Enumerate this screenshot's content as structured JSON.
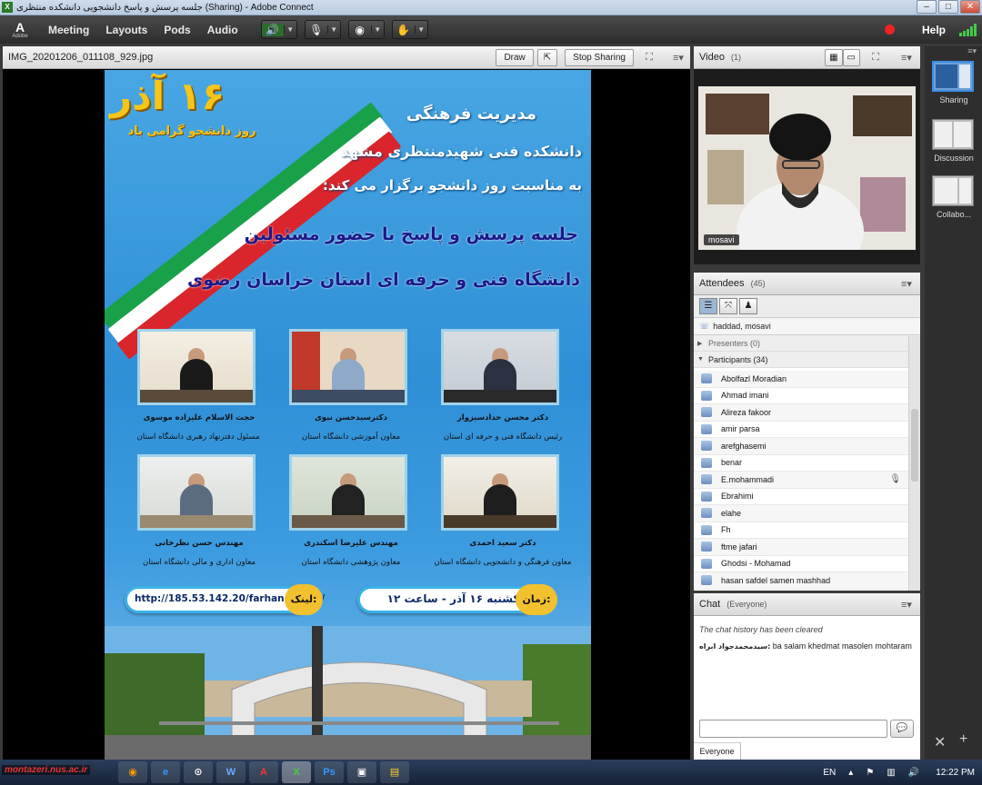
{
  "window": {
    "title": "جلسه پرسش و پاسخ  دانشجویی دانشکده منتظری (Sharing) - Adobe Connect"
  },
  "menubar": {
    "logo_text": "Adobe",
    "items": [
      "Meeting",
      "Layouts",
      "Pods",
      "Audio"
    ],
    "help": "Help"
  },
  "share_pod": {
    "title": "IMG_20201206_011108_929.jpg",
    "draw": "Draw",
    "stop_sharing": "Stop Sharing"
  },
  "poster": {
    "badge_line1": "۱۶ آذر",
    "badge_line2": "روز دانشجو گرامی باد",
    "header1": "مدیریت فرهنگی",
    "header2": "دانشکده فنی شهیدمنتظری مشهد",
    "header3": "به مناسبت روز دانشجو برگزار می کند:",
    "title1": "جلسه پرسش و پاسخ با حضور مسئولین",
    "title2": "دانشگاه فنی و حرفه ای استان خراسان رضوی",
    "people": [
      {
        "name": "دکتر محسن حدادسبزوار",
        "role": "رئیس دانشگاه فنی و حرفه ای استان"
      },
      {
        "name": "دکترسیدحسن نبوی",
        "role": "معاون آموزشی دانشگاه استان"
      },
      {
        "name": "حجت الاسلام علیزاده موسوی",
        "role": "مسئول دفترنهاد رهبری دانشگاه استان"
      },
      {
        "name": "دکتر سعید احمدی",
        "role": "معاون فرهنگی و دانشجویی دانشگاه استان"
      },
      {
        "name": "مهندس علیرضا اسکندری",
        "role": "معاون پژوهشی دانشگاه استان"
      },
      {
        "name": "مهندس حسن نظرخانی",
        "role": "معاون اداری و مالی دانشگاه استان"
      }
    ],
    "time_label": "زمان:",
    "time_value": "یکشنبه ۱۶ آذر - ساعت ۱۲",
    "link_label": "لینک:",
    "link_value": "http://185.53.142.20/farhangi_com/"
  },
  "video_pod": {
    "title": "Video",
    "count": "(1)",
    "user": "mosavi"
  },
  "attendees_pod": {
    "title": "Attendees",
    "count": "(45)",
    "host_line": "haddad, mosavi",
    "presenters": "Presenters (0)",
    "participants": "Participants (34)",
    "list": [
      "Abolfazl Moradian",
      "Ahmad imani",
      "Alireza fakoor",
      "amir parsa",
      "arefghasemi",
      "benar",
      "E.mohammadi",
      "Ebrahimi",
      "elahe",
      "Fh",
      "ftme jafari",
      "Ghodsi - Mohamad",
      "hasan safdel samen mashhad"
    ]
  },
  "chat_pod": {
    "title": "Chat",
    "scope": "(Everyone)",
    "cleared": "The chat history has been cleared",
    "sender": "سیدمحمدجواد ابراه:",
    "message": "ba salam khedmat masolen mohtaram",
    "tab": "Everyone"
  },
  "layouts_rail": [
    "Sharing",
    "Discussion",
    "Collabo..."
  ],
  "taskbar": {
    "watermark": "montazeri.nus.ac.ir",
    "lang": "EN",
    "clock": "12:22 PM"
  }
}
